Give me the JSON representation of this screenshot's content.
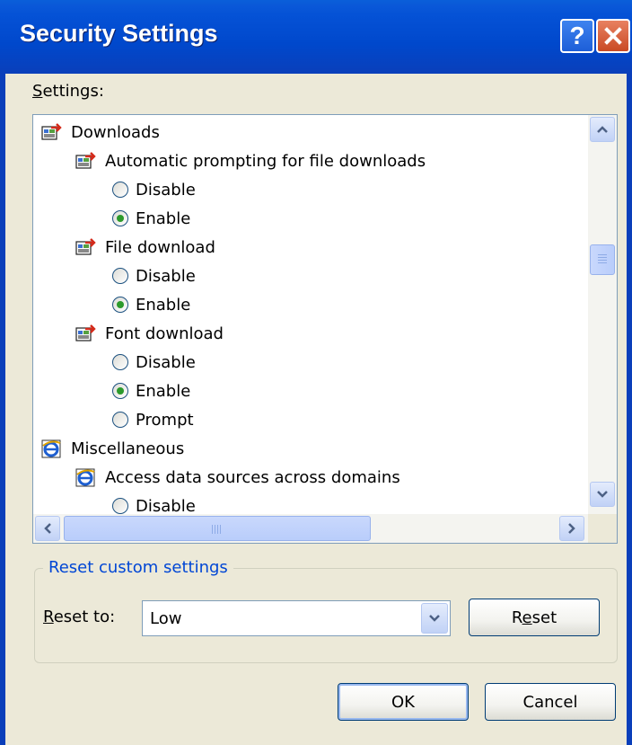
{
  "window": {
    "title": "Security Settings",
    "help_glyph": "?",
    "close_icon": "close-x-icon"
  },
  "settings_label": "Settings:",
  "tree": [
    {
      "type": "category",
      "icon": "download-category-icon",
      "label": "Downloads"
    },
    {
      "type": "setting",
      "icon": "download-setting-icon",
      "label": "Automatic prompting for file downloads"
    },
    {
      "type": "option",
      "label": "Disable",
      "selected": false
    },
    {
      "type": "option",
      "label": "Enable",
      "selected": true
    },
    {
      "type": "setting",
      "icon": "download-setting-icon",
      "label": "File download"
    },
    {
      "type": "option",
      "label": "Disable",
      "selected": false
    },
    {
      "type": "option",
      "label": "Enable",
      "selected": true
    },
    {
      "type": "setting",
      "icon": "download-setting-icon",
      "label": "Font download"
    },
    {
      "type": "option",
      "label": "Disable",
      "selected": false
    },
    {
      "type": "option",
      "label": "Enable",
      "selected": true
    },
    {
      "type": "option",
      "label": "Prompt",
      "selected": false
    },
    {
      "type": "category",
      "icon": "ie-icon",
      "label": "Miscellaneous"
    },
    {
      "type": "setting",
      "icon": "ie-icon",
      "label": "Access data sources across domains"
    },
    {
      "type": "option",
      "label": "Disable",
      "selected": false
    }
  ],
  "reset_group": {
    "legend": "Reset custom settings",
    "reset_to_label": "Reset to:",
    "reset_to_value": "Low",
    "reset_button": "Reset"
  },
  "buttons": {
    "ok": "OK",
    "cancel": "Cancel"
  },
  "colors": {
    "titlebar": "#0048cc",
    "dialog_bg": "#ece9d8",
    "group_legend": "#0046d5",
    "radio_selected": "#2c9a2c"
  }
}
